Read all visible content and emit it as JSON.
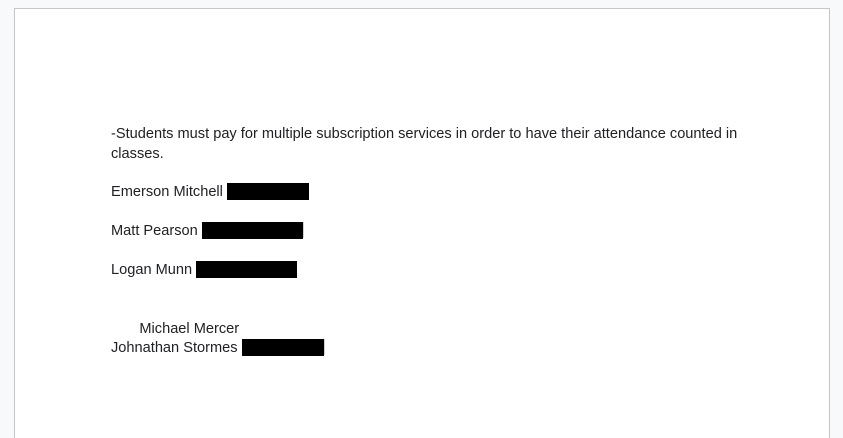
{
  "document": {
    "paragraph": "-Students must pay for multiple subscription services in order to have their attendance counted in classes.",
    "names": [
      {
        "name": "Emerson Mitchell",
        "redacted": true
      },
      {
        "name": "Matt Pearson",
        "redacted": true
      },
      {
        "name": "Logan Munn",
        "redacted": true
      },
      {
        "name": " Michael Mercer",
        "redacted": false
      },
      {
        "name": "Johnathan Stormes",
        "redacted": true
      }
    ]
  },
  "colors": {
    "text": "#202124",
    "redaction": "#000000",
    "page_border": "#c6c6c6"
  }
}
